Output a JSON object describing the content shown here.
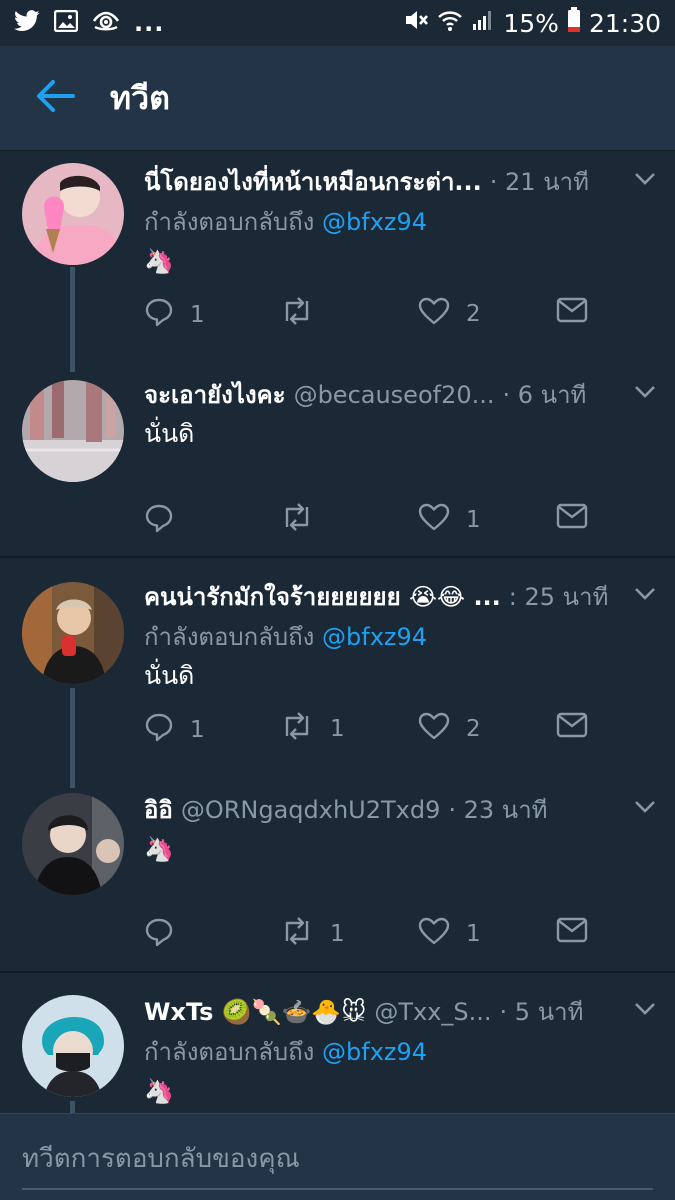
{
  "status_bar": {
    "battery": "15%",
    "time": "21:30",
    "more": "..."
  },
  "header": {
    "title": "ทวีต"
  },
  "tweets": [
    {
      "name": "นี่โดยองไงที่หน้าเหมือนกระต่า...",
      "handle": "",
      "time": "· 21 นาที",
      "reply_prefix": "กำลังตอบกลับถึง ",
      "reply_to": "@bfxz94",
      "text": "🦄",
      "replies": "1",
      "retweets": "",
      "likes": "2"
    },
    {
      "name": "จะเอายังไงคะ",
      "handle": "@becauseof20...",
      "time": "· 6 นาที",
      "text": "นั่นดิ",
      "replies": "",
      "retweets": "",
      "likes": "1"
    },
    {
      "name": "คนน่ารักมักใจร้ายยยยยย 😭😂 ...",
      "handle": "",
      "time": ": 25 นาที",
      "reply_prefix": "กำลังตอบกลับถึง ",
      "reply_to": "@bfxz94",
      "text": "นั่นดิ",
      "replies": "1",
      "retweets": "1",
      "likes": "2"
    },
    {
      "name": "อิอิ",
      "handle": "@ORNgaqdxhU2Txd9",
      "time": "· 23 นาที",
      "text": "🦄",
      "replies": "",
      "retweets": "1",
      "likes": "1"
    },
    {
      "name": "WxTs 🥝🍡🍲🐣🐭",
      "handle": "@Txx_S...",
      "time": "· 5 นาที",
      "reply_prefix": "กำลังตอบกลับถึง ",
      "reply_to": "@bfxz94",
      "text": "🦄"
    }
  ],
  "composer": {
    "placeholder": "ทวีตการตอบกลับของคุณ"
  },
  "colors": {
    "background": "#1b2836",
    "header": "#243447",
    "accent": "#1da1f2",
    "muted": "#8899a6"
  },
  "icons": [
    "twitter-icon",
    "gallery-icon",
    "eye-icon",
    "mute-icon",
    "wifi-icon",
    "signal-icon",
    "battery-icon",
    "back-arrow-icon",
    "chevron-down-icon",
    "reply-icon",
    "retweet-icon",
    "like-icon",
    "message-icon"
  ]
}
